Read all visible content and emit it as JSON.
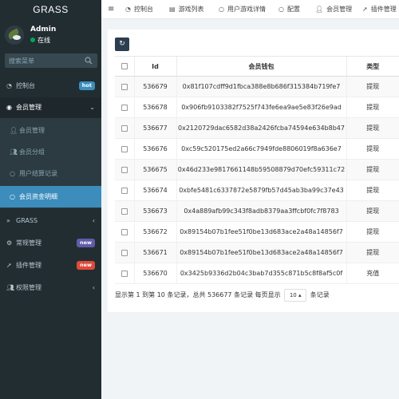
{
  "app": {
    "logo": "GRASS"
  },
  "user": {
    "name": "Admin",
    "status": "在线"
  },
  "search": {
    "placeholder": "搜索菜单"
  },
  "sidebar": {
    "items": [
      {
        "label": "控制台",
        "icon": "dashboard-icon",
        "badge": "hot",
        "badge_color": "#3c8dbc"
      },
      {
        "label": "会员管理",
        "icon": "user-circle-icon",
        "chevron": "⌄"
      },
      {
        "label": "GRASS",
        "icon": "double-chevron-icon",
        "chevron": "‹"
      },
      {
        "label": "常规管理",
        "icon": "gears-icon",
        "badge": "new",
        "badge_color": "#605ca8"
      },
      {
        "label": "插件管理",
        "icon": "rocket-icon",
        "badge": "new",
        "badge_color": "#dd4b39"
      },
      {
        "label": "权限管理",
        "icon": "group-icon",
        "chevron": "‹"
      }
    ],
    "submenu": [
      {
        "label": "会员管理",
        "icon": "user-icon"
      },
      {
        "label": "会员分组",
        "icon": "users-icon"
      },
      {
        "label": "用户结算记录",
        "icon": "circle-icon"
      },
      {
        "label": "会员资金明细",
        "icon": "circle-icon",
        "active": true
      }
    ]
  },
  "topnav": {
    "menu_icon": "menu-icon",
    "items": [
      {
        "label": "控制台",
        "icon": "dashboard-icon"
      },
      {
        "label": "游戏列表",
        "icon": "list-icon"
      },
      {
        "label": "用户游戏详情",
        "icon": "circle-icon"
      },
      {
        "label": "配置",
        "icon": "circle-icon"
      },
      {
        "label": "会员管理",
        "icon": "user-icon"
      },
      {
        "label": "插件管理",
        "icon": "rocket-icon"
      }
    ]
  },
  "table": {
    "headers": {
      "id": "Id",
      "wallet": "会员钱包",
      "type": "类型"
    },
    "rows": [
      {
        "id": "536679",
        "wallet": "0x81f107cdff9d1fbca388e8b686f315384b719fe7",
        "type": "提现",
        "link": true
      },
      {
        "id": "536678",
        "wallet": "0x906fb9103382f7525f743fe6ea9ae5e83f26e9ad",
        "type": "提现",
        "link": true
      },
      {
        "id": "536677",
        "wallet": "0x2120729dac6582d38a2426fcba74594e634b8b47",
        "type": "提现",
        "link": true
      },
      {
        "id": "536676",
        "wallet": "0xc59c520175ed2a66c7949fde8806019f8a636e7",
        "type": "提现",
        "link": true
      },
      {
        "id": "536675",
        "wallet": "0x46d233e9817661148b59508879d70efc59311c72",
        "type": "提现",
        "link": true
      },
      {
        "id": "536674",
        "wallet": "0xbfe5481c6337872e5879fb57d45ab3ba99c37e43",
        "type": "提现",
        "link": true
      },
      {
        "id": "536673",
        "wallet": "0x4a889afb99c343f8adb8379aa3ffcbf0fc7f8783",
        "type": "提现",
        "link": true
      },
      {
        "id": "536672",
        "wallet": "0x89154b07b1fee51f0be13d683ace2a48a14856f7",
        "type": "提现",
        "link": true
      },
      {
        "id": "536671",
        "wallet": "0x89154b07b1fee51f0be13d683ace2a48a14856f7",
        "type": "提现",
        "link": true
      },
      {
        "id": "536670",
        "wallet": "0x3425b9336d2b04c3bab7d355c871b5c8f8af5c0f",
        "type": "充值",
        "link": false
      }
    ]
  },
  "pager": {
    "summary": "显示第 1 到第 10 条记录，总共 536677 条记录 每页显示",
    "page_size": "10 ▴",
    "suffix": "条记录"
  },
  "colors": {
    "sidebar_bg": "#222d32",
    "active": "#3c8dbc",
    "link": "#18bc9c"
  }
}
